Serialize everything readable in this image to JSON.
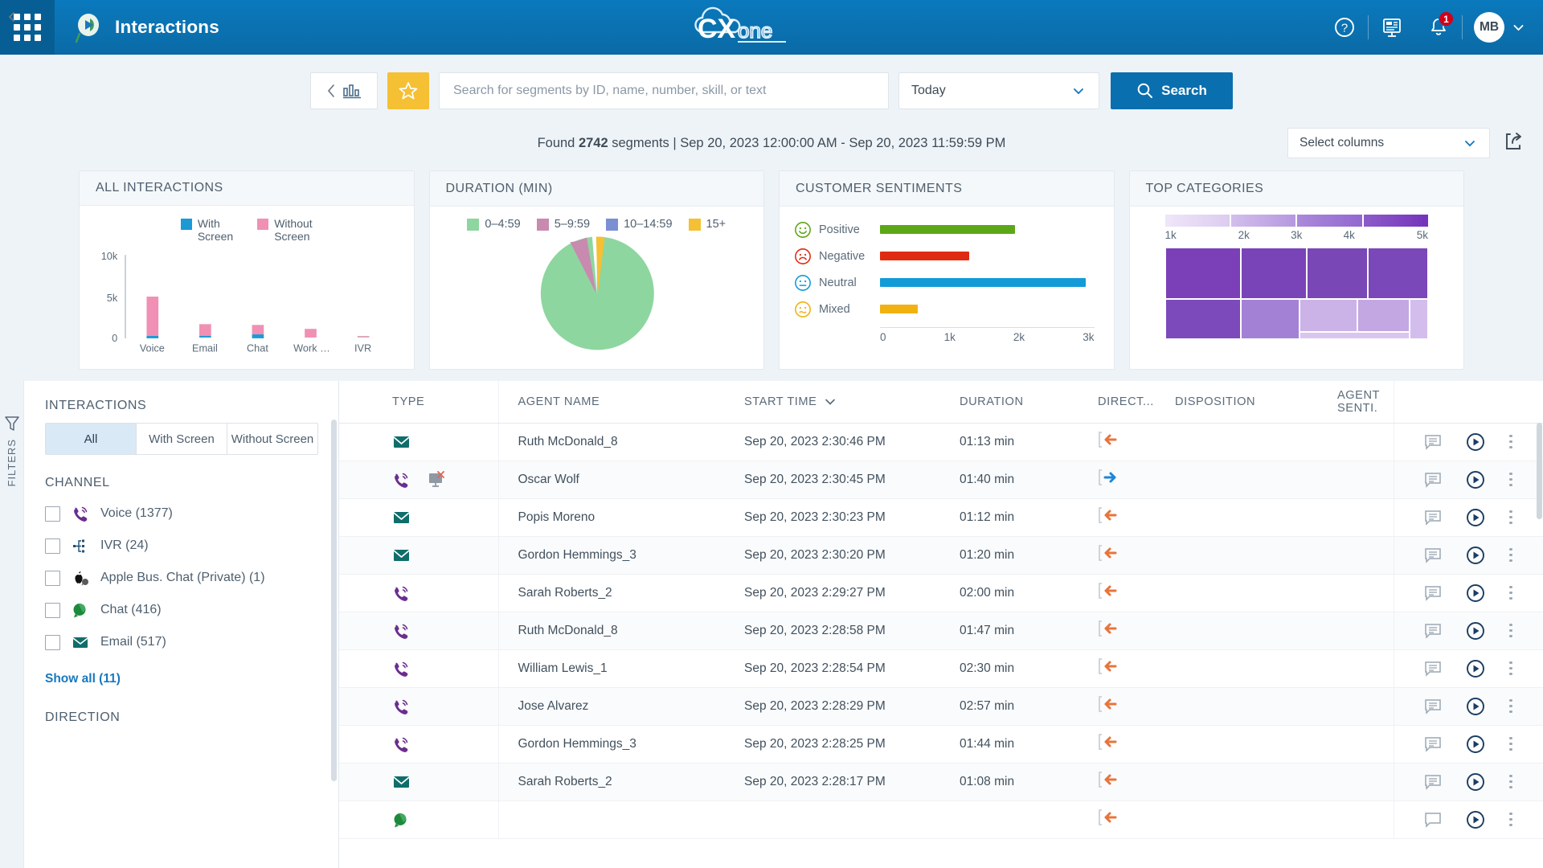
{
  "header": {
    "app_title": "Interactions",
    "logo_text": "CXone",
    "waffle_icon": "app-grid-icon",
    "app_icon": "interactions-play-icon",
    "help_icon": "help-circle-icon",
    "dashboard_icon": "presentation-board-icon",
    "bell_icon": "notification-bell-icon",
    "notification_count": "1",
    "avatar_initials": "MB",
    "avatar_chevron_icon": "chevron-down-icon"
  },
  "searchbar": {
    "chart_toggle_icon": "bar-chart-icon",
    "back_chevron_icon": "chevron-left-icon",
    "favorite_icon": "star-icon",
    "placeholder": "Search for segments by ID, name, number, skill, or text",
    "search_value": "",
    "date_range": "Today",
    "date_chevron_icon": "chevron-down-icon",
    "search_label": "Search",
    "search_icon": "magnifier-icon"
  },
  "results": {
    "found_prefix": "Found ",
    "count": "2742",
    "found_suffix": " segments | Sep 20, 2023 12:00:00 AM - Sep 20, 2023 11:59:59 PM",
    "select_columns": "Select columns",
    "select_columns_chevron_icon": "chevron-down-icon",
    "export_icon": "export-share-icon"
  },
  "widgets": {
    "all_interactions_title": "ALL INTERACTIONS",
    "duration_title": "DURATION (MIN)",
    "sentiments_title": "CUSTOMER SENTIMENTS",
    "categories_title": "TOP CATEGORIES"
  },
  "chart_data": [
    {
      "type": "bar",
      "title": "ALL INTERACTIONS",
      "categories": [
        "Voice",
        "Email",
        "Chat",
        "Work ...",
        "IVR"
      ],
      "series": [
        {
          "name": "With Screen",
          "color": "#1b9ad6",
          "values": [
            130,
            70,
            160,
            0,
            0
          ]
        },
        {
          "name": "Without Screen",
          "color": "#f090b4",
          "values": [
            5000,
            1450,
            1150,
            830,
            40
          ]
        }
      ],
      "legend": [
        "With Screen",
        "Without Screen"
      ],
      "legend_position": "top",
      "ylabel": "",
      "xlabel": "",
      "yticks": [
        "0",
        "5k",
        "10k"
      ],
      "ylim": [
        0,
        10000
      ],
      "grid": false,
      "stacked": true
    },
    {
      "type": "pie",
      "title": "DURATION (MIN)",
      "categories": [
        "0-4:59",
        "5-9:59",
        "10-14:59",
        "15+"
      ],
      "values": [
        91,
        6,
        0,
        3
      ],
      "colors": [
        "#8ed6a0",
        "#c98ab0",
        "#7b8fd4",
        "#f5c033"
      ],
      "legend": [
        "0-4:59",
        "5-9:59",
        "10-14:59",
        "15+"
      ],
      "legend_position": "top"
    },
    {
      "type": "bar",
      "title": "CUSTOMER SENTIMENTS",
      "orientation": "horizontal",
      "categories": [
        "Positive",
        "Negative",
        "Neutral",
        "Mixed"
      ],
      "values": [
        1900,
        1250,
        2880,
        530
      ],
      "colors": [
        "#5ca717",
        "#e02b13",
        "#139bd8",
        "#f1b211"
      ],
      "xticks": [
        "0",
        "1k",
        "2k",
        "3k"
      ],
      "xlim": [
        0,
        3000
      ],
      "grid": false
    },
    {
      "type": "heatmap",
      "title": "TOP CATEGORIES",
      "subtype": "treemap",
      "legend_ticks": [
        "1k",
        "2k",
        "3k",
        "4k",
        "5k"
      ],
      "legend_colors": [
        "#e6d9f2",
        "#c9b0e3",
        "#a87fd4",
        "#8347c4"
      ],
      "cells": [
        {
          "x": 0,
          "y": 0,
          "w": 29,
          "h": 56,
          "value": 5000,
          "color": "#7b3fb8"
        },
        {
          "x": 29,
          "y": 0,
          "w": 25,
          "h": 56,
          "value": 4600,
          "color": "#7944b7"
        },
        {
          "x": 54,
          "y": 0,
          "w": 23,
          "h": 56,
          "value": 4400,
          "color": "#7a47b7"
        },
        {
          "x": 77,
          "y": 0,
          "w": 23,
          "h": 56,
          "value": 4300,
          "color": "#7a48b8"
        },
        {
          "x": 0,
          "y": 56,
          "w": 29,
          "h": 44,
          "value": 4100,
          "color": "#7c4abb"
        },
        {
          "x": 29,
          "y": 56,
          "w": 22,
          "h": 44,
          "value": 2600,
          "color": "#a382d6"
        },
        {
          "x": 51,
          "y": 56,
          "w": 22,
          "h": 36,
          "value": 1600,
          "color": "#cbb2e7"
        },
        {
          "x": 73,
          "y": 56,
          "w": 20,
          "h": 36,
          "value": 1700,
          "color": "#c3a7e2"
        },
        {
          "x": 93,
          "y": 56,
          "w": 7,
          "h": 44,
          "value": 1400,
          "color": "#d3bded"
        },
        {
          "x": 51,
          "y": 92,
          "w": 42,
          "h": 8,
          "value": 900,
          "color": "#d9c6ef"
        }
      ]
    }
  ],
  "filters": {
    "rail_label": "FILTERS",
    "filter_icon": "funnel-icon",
    "collapse_icon": "chevron-left-icon",
    "interactions_title": "INTERACTIONS",
    "segments": [
      {
        "label": "All",
        "active": true
      },
      {
        "label": "With Screen",
        "active": false
      },
      {
        "label": "Without Screen",
        "active": false
      }
    ],
    "channel_title": "CHANNEL",
    "channels": [
      {
        "icon": "voice-phone-icon",
        "label": "Voice (1377)"
      },
      {
        "icon": "ivr-tree-icon",
        "label": "IVR (24)"
      },
      {
        "icon": "apple-chat-icon",
        "label": "Apple Bus. Chat (Private) (1)"
      },
      {
        "icon": "chat-bubble-icon",
        "label": "Chat (416)"
      },
      {
        "icon": "email-envelope-icon",
        "label": "Email (517)"
      }
    ],
    "show_all": "Show all (11)",
    "direction_title": "DIRECTION"
  },
  "table": {
    "columns": [
      {
        "key": "type",
        "label": "TYPE"
      },
      {
        "key": "agent",
        "label": "AGENT NAME"
      },
      {
        "key": "start",
        "label": "START TIME",
        "sort_icon": "chevron-down-icon"
      },
      {
        "key": "duration",
        "label": "DURATION"
      },
      {
        "key": "direction",
        "label": "DIRECT..."
      },
      {
        "key": "disposition",
        "label": "DISPOSITION"
      },
      {
        "key": "sentiment",
        "label": "AGENT SENTI."
      },
      {
        "key": "actions",
        "label": ""
      }
    ],
    "rows": [
      {
        "type": "email",
        "screen": false,
        "agent": "Ruth McDonald_8",
        "start": "Sep 20, 2023 2:30:46 PM",
        "duration": "01:13 min",
        "direction": "inbound",
        "disposition": "",
        "sentiment": ""
      },
      {
        "type": "voice",
        "screen": true,
        "agent": "Oscar Wolf",
        "start": "Sep 20, 2023 2:30:45 PM",
        "duration": "01:40 min",
        "direction": "outbound",
        "disposition": "",
        "sentiment": ""
      },
      {
        "type": "email",
        "screen": false,
        "agent": "Popis Moreno",
        "start": "Sep 20, 2023 2:30:23 PM",
        "duration": "01:12 min",
        "direction": "inbound",
        "disposition": "",
        "sentiment": ""
      },
      {
        "type": "email",
        "screen": false,
        "agent": "Gordon Hemmings_3",
        "start": "Sep 20, 2023 2:30:20 PM",
        "duration": "01:20 min",
        "direction": "inbound",
        "disposition": "",
        "sentiment": ""
      },
      {
        "type": "voice",
        "screen": false,
        "agent": "Sarah Roberts_2",
        "start": "Sep 20, 2023 2:29:27 PM",
        "duration": "02:00 min",
        "direction": "inbound",
        "disposition": "",
        "sentiment": ""
      },
      {
        "type": "voice",
        "screen": false,
        "agent": "Ruth McDonald_8",
        "start": "Sep 20, 2023 2:28:58 PM",
        "duration": "01:47 min",
        "direction": "inbound",
        "disposition": "",
        "sentiment": ""
      },
      {
        "type": "voice",
        "screen": false,
        "agent": "William Lewis_1",
        "start": "Sep 20, 2023 2:28:54 PM",
        "duration": "02:30 min",
        "direction": "inbound",
        "disposition": "",
        "sentiment": ""
      },
      {
        "type": "voice",
        "screen": false,
        "agent": "Jose Alvarez",
        "start": "Sep 20, 2023 2:28:29 PM",
        "duration": "02:57 min",
        "direction": "inbound",
        "disposition": "",
        "sentiment": ""
      },
      {
        "type": "voice",
        "screen": false,
        "agent": "Gordon Hemmings_3",
        "start": "Sep 20, 2023 2:28:25 PM",
        "duration": "01:44 min",
        "direction": "inbound",
        "disposition": "",
        "sentiment": ""
      },
      {
        "type": "email",
        "screen": false,
        "agent": "Sarah Roberts_2",
        "start": "Sep 20, 2023 2:28:17 PM",
        "duration": "01:08 min",
        "direction": "inbound",
        "disposition": "",
        "sentiment": ""
      },
      {
        "type": "chat",
        "screen": false,
        "agent": "",
        "start": "",
        "duration": "",
        "direction": "inbound",
        "disposition": "",
        "sentiment": ""
      }
    ],
    "row_icons": {
      "comment_icon": "transcript-comment-icon",
      "play_icon": "play-circle-icon",
      "more_icon": "kebab-more-icon",
      "no_screen_icon": "monitor-no-recording-icon"
    }
  },
  "colors": {
    "brand_blue": "#0a6fae",
    "header_blue": "#0b71b0",
    "accent_yellow": "#f5c033",
    "bg_light": "#eef3f8",
    "voice_purple": "#6b2d8f",
    "email_teal": "#0f6e6a",
    "chat_green": "#1c8a3c",
    "inbound_orange": "#e8743b",
    "outbound_blue": "#1d86d8"
  }
}
